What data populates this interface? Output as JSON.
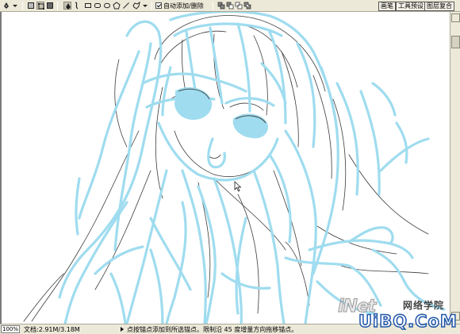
{
  "options_bar": {
    "auto_add_delete_label": "自动添加/删除",
    "palette_tabs": [
      "画笔",
      "工具预设",
      "图层复合"
    ]
  },
  "status_bar": {
    "zoom": "100%",
    "doc_size": "文档:2.91M/3.18M",
    "hint": "点按锚点添加到所选锚点。限制沿 45 度增量方向拖移锚点。"
  },
  "watermark": {
    "brand": "iNet",
    "cn_text": "网络学院",
    "url": "UiBQ.CoM"
  },
  "colors": {
    "sketch_stroke": "#9fdcef",
    "lineart": "#3a3a3a",
    "ui_face": "#ece9d8"
  }
}
